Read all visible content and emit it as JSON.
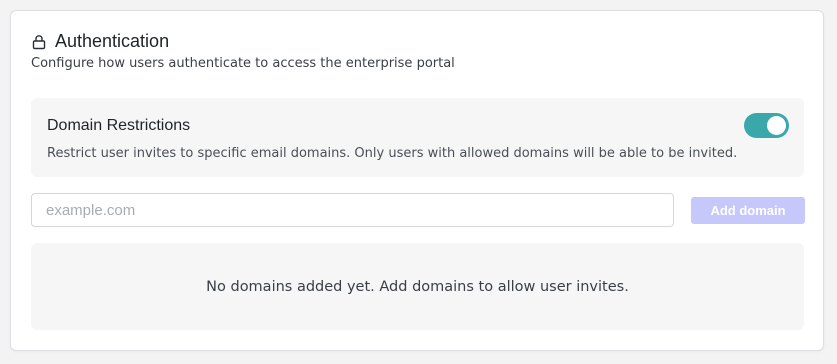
{
  "section": {
    "icon": "lock-icon",
    "title": "Authentication",
    "subtitle": "Configure how users authenticate to access the enterprise portal"
  },
  "domain_restrictions": {
    "title": "Domain Restrictions",
    "description": "Restrict user invites to specific email domains. Only users with allowed domains will be able to be invited.",
    "enabled": true,
    "toggle_color": "#3aa7ab"
  },
  "add_domain": {
    "placeholder": "example.com",
    "value": "",
    "button_label": "Add domain",
    "button_color": "#c6c8fb"
  },
  "domains": {
    "items": [],
    "empty_message": "No domains added yet. Add domains to allow user invites."
  }
}
